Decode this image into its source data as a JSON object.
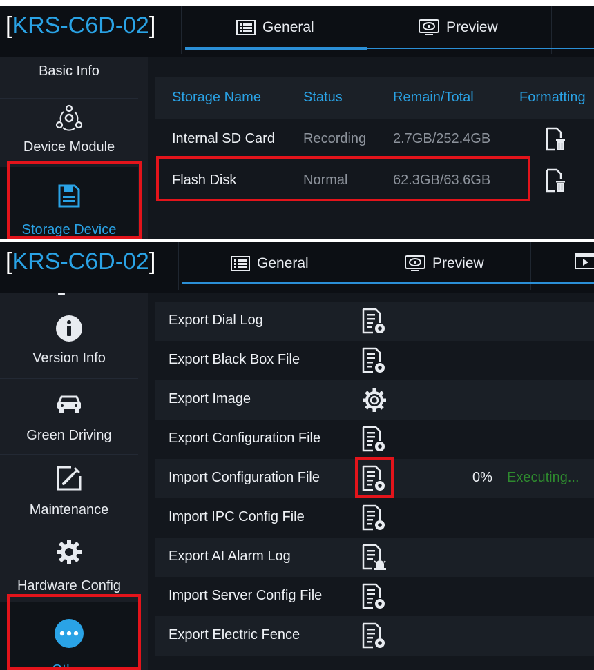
{
  "device_title": "KRS-C6D-02",
  "tabs": {
    "general": "General",
    "preview": "Preview"
  },
  "storage_screen": {
    "sidebar": [
      {
        "label": "Basic Info",
        "icon": "basic-info-icon"
      },
      {
        "label": "Device Module",
        "icon": "device-module-icon"
      },
      {
        "label": "Storage Device",
        "icon": "storage-device-icon",
        "active": true
      }
    ],
    "table": {
      "headers": [
        "Storage Name",
        "Status",
        "Remain/Total",
        "Formatting"
      ],
      "rows": [
        {
          "name": "Internal SD Card",
          "status": "Recording",
          "remain_total": "2.7GB/252.4GB",
          "action_icon": "format-trash-icon"
        },
        {
          "name": "Flash Disk",
          "status": "Normal",
          "remain_total": "62.3GB/63.6GB",
          "action_icon": "format-trash-icon",
          "highlighted": true
        }
      ]
    }
  },
  "other_screen": {
    "sidebar": [
      {
        "label": "Version Info",
        "icon": "info-icon"
      },
      {
        "label": "Green Driving",
        "icon": "car-icon"
      },
      {
        "label": "Maintenance",
        "icon": "maintenance-icon"
      },
      {
        "label": "Hardware Config",
        "icon": "gear-icon"
      },
      {
        "label": "Other",
        "icon": "more-icon",
        "active": true
      }
    ],
    "items": [
      {
        "label": "Export Dial Log",
        "icon": "doc-gear-icon"
      },
      {
        "label": "Export Black Box File",
        "icon": "doc-gear-icon"
      },
      {
        "label": "Export Image",
        "icon": "camera-gear-icon"
      },
      {
        "label": "Export Configuration File",
        "icon": "doc-gear-icon"
      },
      {
        "label": "Import Configuration File",
        "icon": "doc-gear-icon",
        "progress": 0,
        "progress_text": "0%",
        "status": "Executing..."
      },
      {
        "label": "Import IPC Config File",
        "icon": "doc-gear-icon"
      },
      {
        "label": "Export AI Alarm Log",
        "icon": "doc-alarm-icon"
      },
      {
        "label": "Import Server Config File",
        "icon": "doc-gear-icon"
      },
      {
        "label": "Export Electric Fence",
        "icon": "doc-gear-icon"
      }
    ]
  },
  "colors": {
    "accent": "#2aa3e6",
    "highlight": "#e3141b",
    "executing": "#2e8a2e",
    "background": "#12161c"
  }
}
